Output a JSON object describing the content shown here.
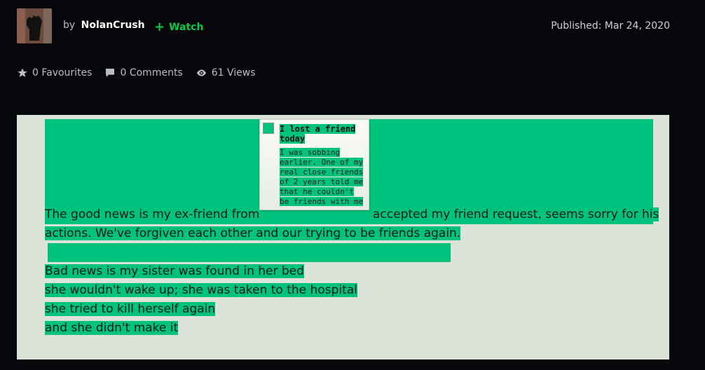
{
  "header": {
    "by_label": "by",
    "username": "NolanCrush",
    "watch_label": "Watch",
    "published": "Published: Mar 24, 2020"
  },
  "stats": {
    "favourites": "0 Favourites",
    "comments": "0 Comments",
    "views": "61 Views"
  },
  "card": {
    "title": "I lost a friend today",
    "body": "I was sobbing earlier. One of my real close friends of 2 years told me that he couldn't be friends with me"
  },
  "content": {
    "line1a": "The good news is my ex-friend from",
    "line1b": "accepted my friend request, seems sorry for his",
    "line2": "actions. We've forgiven each other and our trying to be friends again.",
    "line3": "Bad news is my sister was found in her bed",
    "line4": "she wouldn't  wake up; she was taken to the hospital",
    "line5": "she tried to kill herself again",
    "line6": "and she didn't make it"
  },
  "colors": {
    "highlight": "#00c27f",
    "panel": "#dce4da",
    "accent": "#05cc47",
    "background": "#06070b"
  }
}
